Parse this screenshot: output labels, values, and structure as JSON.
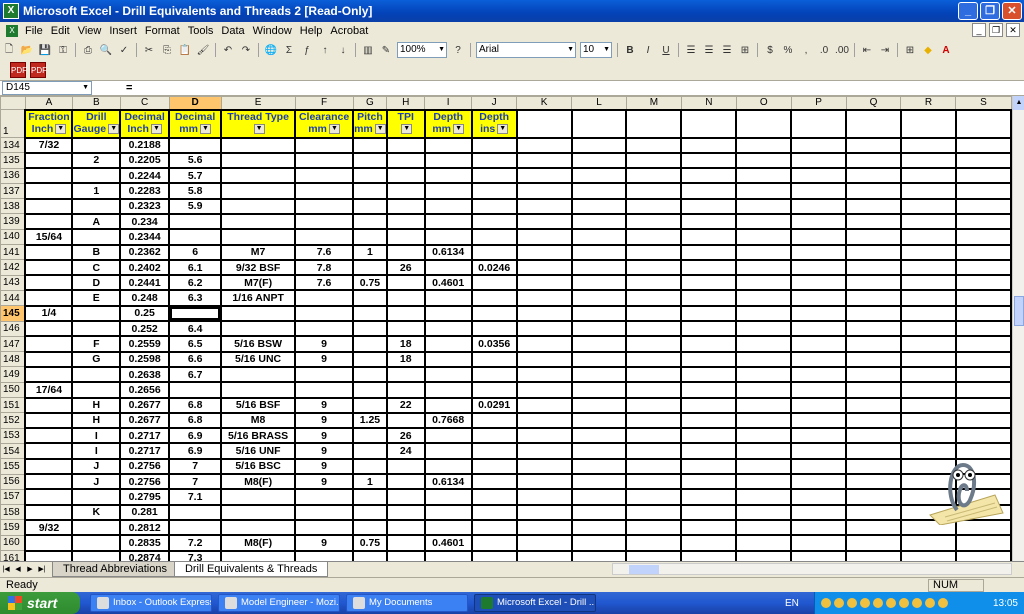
{
  "window": {
    "title": "Microsoft Excel - Drill Equivalents and Threads 2  [Read-Only]"
  },
  "menu": {
    "items": [
      "File",
      "Edit",
      "View",
      "Insert",
      "Format",
      "Tools",
      "Data",
      "Window",
      "Help",
      "Acrobat"
    ]
  },
  "toolbar": {
    "zoom": "100%",
    "font": "Arial",
    "size": "10"
  },
  "formula_bar": {
    "cell": "D145",
    "eq": "="
  },
  "grid": {
    "columns": [
      "A",
      "B",
      "C",
      "D",
      "E",
      "F",
      "G",
      "H",
      "I",
      "J",
      "K",
      "L",
      "M",
      "N",
      "O",
      "P",
      "Q",
      "R",
      "S"
    ],
    "header_row_number": "1",
    "headers": [
      [
        "Fraction",
        "Inch"
      ],
      [
        "Drill",
        "Gauge"
      ],
      [
        "Decimal",
        "Inch"
      ],
      [
        "Decimal",
        "mm"
      ],
      [
        "Thread Type",
        ""
      ],
      [
        "Clearance",
        "mm"
      ],
      [
        "Pitch",
        "mm"
      ],
      [
        "TPI",
        ""
      ],
      [
        "Depth",
        "mm"
      ],
      [
        "Depth",
        "ins"
      ]
    ],
    "rows": [
      [
        "134",
        "7/32",
        "",
        "0.2188",
        "",
        "",
        "",
        "",
        "",
        "",
        ""
      ],
      [
        "135",
        "",
        "2",
        "0.2205",
        "5.6",
        "",
        "",
        "",
        "",
        "",
        ""
      ],
      [
        "136",
        "",
        "",
        "0.2244",
        "5.7",
        "",
        "",
        "",
        "",
        "",
        ""
      ],
      [
        "137",
        "",
        "1",
        "0.2283",
        "5.8",
        "",
        "",
        "",
        "",
        "",
        ""
      ],
      [
        "138",
        "",
        "",
        "0.2323",
        "5.9",
        "",
        "",
        "",
        "",
        "",
        ""
      ],
      [
        "139",
        "",
        "A",
        "0.234",
        "",
        "",
        "",
        "",
        "",
        "",
        ""
      ],
      [
        "140",
        "15/64",
        "",
        "0.2344",
        "",
        "",
        "",
        "",
        "",
        "",
        ""
      ],
      [
        "141",
        "",
        "B",
        "0.2362",
        "6",
        "M7",
        "7.6",
        "1",
        "",
        "0.6134",
        ""
      ],
      [
        "142",
        "",
        "C",
        "0.2402",
        "6.1",
        "9/32 BSF",
        "7.8",
        "",
        "26",
        "",
        "0.0246"
      ],
      [
        "143",
        "",
        "D",
        "0.2441",
        "6.2",
        "M7(F)",
        "7.6",
        "0.75",
        "",
        "0.4601",
        ""
      ],
      [
        "144",
        "",
        "E",
        "0.248",
        "6.3",
        "1/16 ANPT",
        "",
        "",
        "",
        "",
        ""
      ],
      [
        "145",
        "1/4",
        "",
        "0.25",
        "",
        "",
        "",
        "",
        "",
        "",
        ""
      ],
      [
        "146",
        "",
        "",
        "0.252",
        "6.4",
        "",
        "",
        "",
        "",
        "",
        ""
      ],
      [
        "147",
        "",
        "F",
        "0.2559",
        "6.5",
        "5/16 BSW",
        "9",
        "",
        "18",
        "",
        "0.0356"
      ],
      [
        "148",
        "",
        "G",
        "0.2598",
        "6.6",
        "5/16 UNC",
        "9",
        "",
        "18",
        "",
        ""
      ],
      [
        "149",
        "",
        "",
        "0.2638",
        "6.7",
        "",
        "",
        "",
        "",
        "",
        ""
      ],
      [
        "150",
        "17/64",
        "",
        "0.2656",
        "",
        "",
        "",
        "",
        "",
        "",
        ""
      ],
      [
        "151",
        "",
        "H",
        "0.2677",
        "6.8",
        "5/16 BSF",
        "9",
        "",
        "22",
        "",
        "0.0291"
      ],
      [
        "152",
        "",
        "H",
        "0.2677",
        "6.8",
        "M8",
        "9",
        "1.25",
        "",
        "0.7668",
        ""
      ],
      [
        "153",
        "",
        "I",
        "0.2717",
        "6.9",
        "5/16 BRASS",
        "9",
        "",
        "26",
        "",
        ""
      ],
      [
        "154",
        "",
        "I",
        "0.2717",
        "6.9",
        "5/16 UNF",
        "9",
        "",
        "24",
        "",
        ""
      ],
      [
        "155",
        "",
        "J",
        "0.2756",
        "7",
        "5/16 BSC",
        "9",
        "",
        "",
        "",
        ""
      ],
      [
        "156",
        "",
        "J",
        "0.2756",
        "7",
        "M8(F)",
        "9",
        "1",
        "",
        "0.6134",
        ""
      ],
      [
        "157",
        "",
        "",
        "0.2795",
        "7.1",
        "",
        "",
        "",
        "",
        "",
        ""
      ],
      [
        "158",
        "",
        "K",
        "0.281",
        "",
        "",
        "",
        "",
        "",
        "",
        ""
      ],
      [
        "159",
        "9/32",
        "",
        "0.2812",
        "",
        "",
        "",
        "",
        "",
        "",
        ""
      ],
      [
        "160",
        "",
        "",
        "0.2835",
        "7.2",
        "M8(F)",
        "9",
        "0.75",
        "",
        "0.4601",
        ""
      ],
      [
        "161",
        "",
        "",
        "0.2874",
        "7.3",
        "",
        "",
        "",
        "",
        "",
        ""
      ]
    ]
  },
  "sheets": {
    "tabs": [
      "Thread Abbreviations",
      "Drill Equivalents & Threads"
    ]
  },
  "status": {
    "left": "Ready",
    "num": "NUM"
  },
  "taskbar": {
    "start": "start",
    "tasks": [
      "Inbox - Outlook Express",
      "Model Engineer - Mozi...",
      "My Documents",
      "Microsoft Excel - Drill ..."
    ],
    "lang": "EN",
    "clock": "13:05"
  }
}
